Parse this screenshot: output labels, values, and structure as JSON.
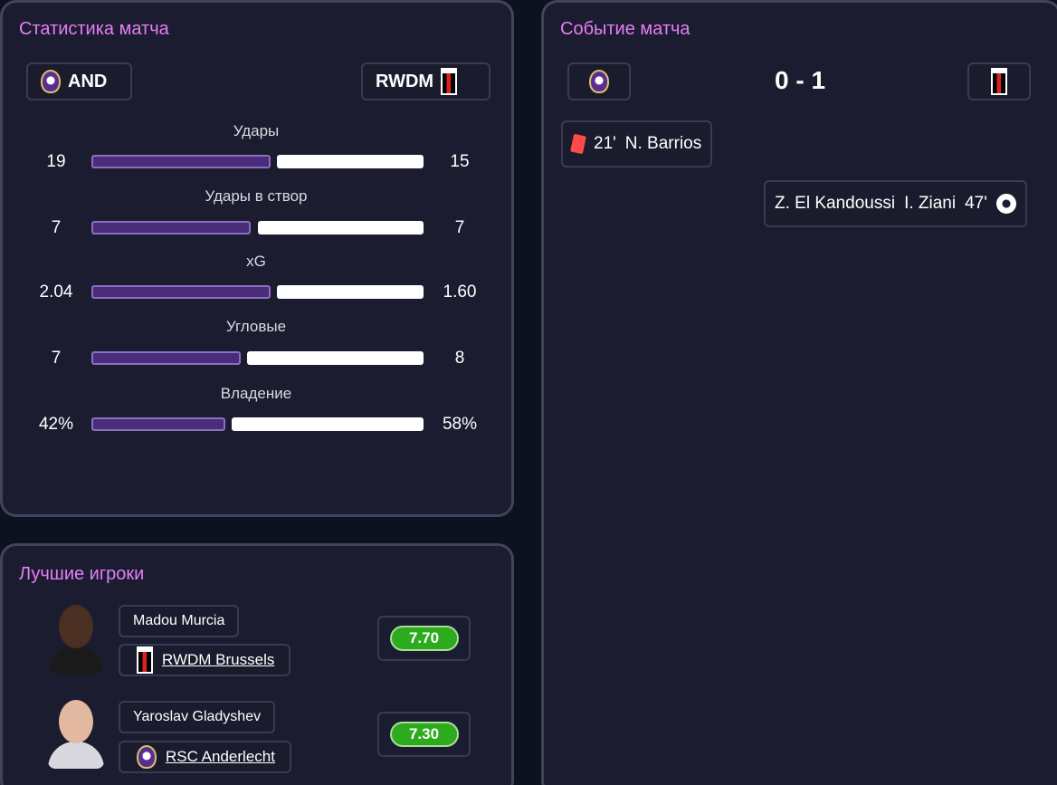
{
  "stats_panel": {
    "title": "Статистика матча",
    "home_team": "AND",
    "away_team": "RWDM",
    "rows": [
      {
        "label": "Удары",
        "home": "19",
        "away": "15"
      },
      {
        "label": "Удары в створ",
        "home": "7",
        "away": "7"
      },
      {
        "label": "xG",
        "home": "2.04",
        "away": "1.60"
      },
      {
        "label": "Угловые",
        "home": "7",
        "away": "8"
      },
      {
        "label": "Владение",
        "home": "42%",
        "away": "58%"
      }
    ]
  },
  "events_panel": {
    "title": "Событие матча",
    "score": "0 - 1",
    "events": [
      {
        "type": "red-card",
        "minute": "21'",
        "player": "N. Barrios",
        "side": "home"
      },
      {
        "type": "goal",
        "minute": "47'",
        "player": "I. Ziani",
        "assist": "Z. El Kandoussi",
        "side": "away"
      }
    ]
  },
  "players_panel": {
    "title": "Лучшие игроки",
    "players": [
      {
        "name": "Madou Murcia",
        "club": "RWDM Brussels",
        "club_icon": "rwdm-crest-icon",
        "rating": "7.70"
      },
      {
        "name": "Yaroslav Gladyshev",
        "club": "RSC Anderlecht",
        "club_icon": "anderlecht-crest-icon",
        "rating": "7.30"
      }
    ]
  },
  "colors": {
    "title_accent": "#e57ef5",
    "home_bar": "#4a2c7a",
    "away_bar": "#ffffff",
    "rating_green": "#2eaa1e",
    "red_card": "#ff4a4a"
  }
}
